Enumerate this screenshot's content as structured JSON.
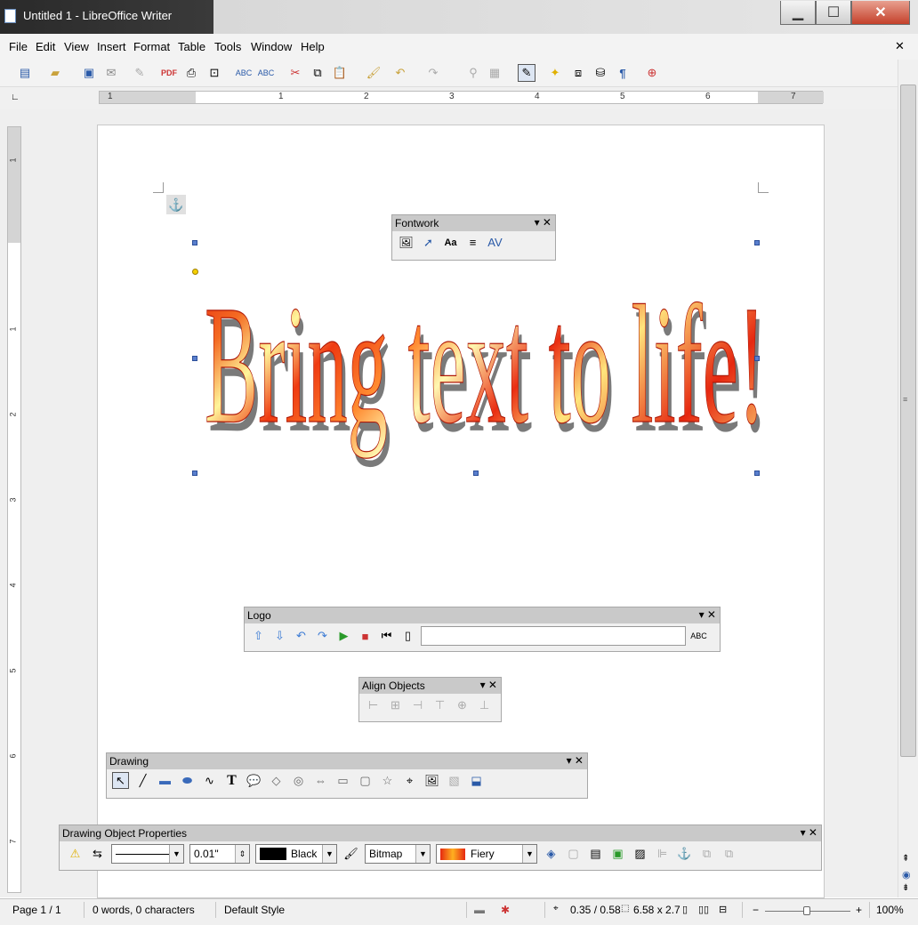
{
  "window": {
    "title": "Untitled 1 - LibreOffice Writer",
    "minimize": "▁",
    "maximize": "☐",
    "close": "✕"
  },
  "menu": [
    "File",
    "Edit",
    "View",
    "Insert",
    "Format",
    "Table",
    "Tools",
    "Window",
    "Help"
  ],
  "doc_close": "✕",
  "ruler": {
    "h_numbers": [
      "1",
      "1",
      "2",
      "3",
      "4",
      "5",
      "6",
      "7"
    ],
    "v_numbers": [
      "1",
      "1",
      "2",
      "3",
      "4",
      "5",
      "6",
      "7"
    ]
  },
  "fontwork": {
    "text": "Bring text to life!",
    "colors": {
      "red": "#e62810",
      "yellow": "#fff59a"
    }
  },
  "anchor_icon": "⚓",
  "panels": {
    "fontwork": {
      "title": "Fontwork"
    },
    "logo": {
      "title": "Logo",
      "command_value": ""
    },
    "align": {
      "title": "Align Objects"
    },
    "drawing": {
      "title": "Drawing"
    },
    "props": {
      "title": "Drawing Object Properties",
      "line_width": "0.01\"",
      "line_color": "Black",
      "area_style": "Bitmap",
      "bitmap": "Fiery"
    }
  },
  "status": {
    "page": "Page 1 / 1",
    "words": "0 words, 0 characters",
    "style": "Default Style",
    "position": "0.35 / 0.58",
    "size": "6.58 x 2.7",
    "zoom": "100%"
  }
}
